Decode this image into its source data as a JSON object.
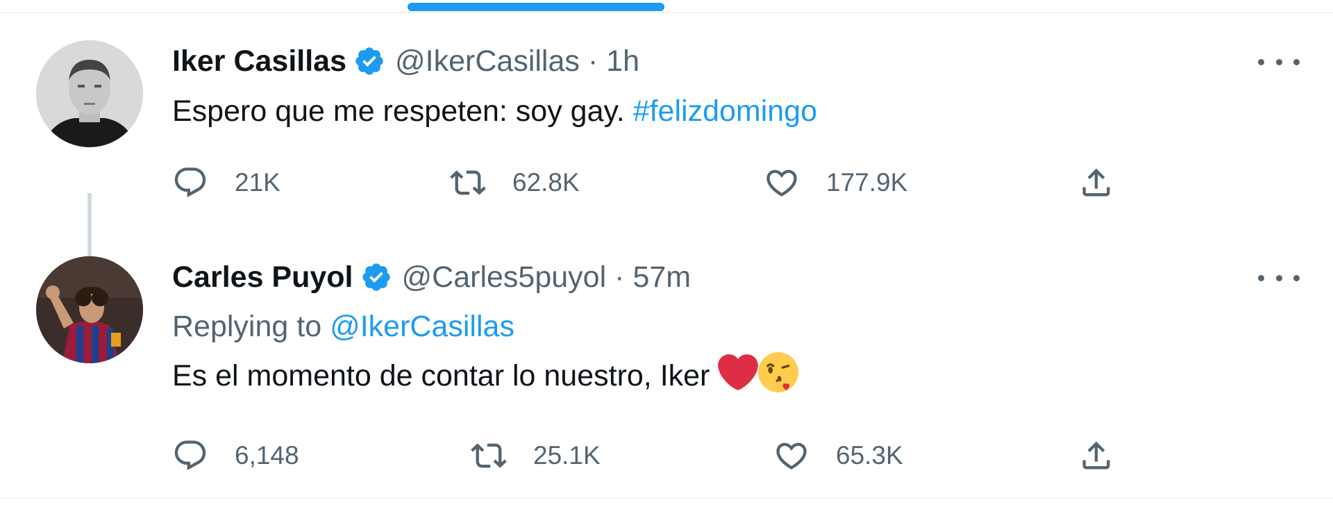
{
  "tabs": {
    "active_indicator_color": "#1d9bf0"
  },
  "tweets": [
    {
      "display_name": "Iker Casillas",
      "verified": true,
      "handle": "@IkerCasillas",
      "separator": "·",
      "time": "1h",
      "text_plain": "Espero que me respeten: soy gay. ",
      "hashtag": "#felizdomingo",
      "avatar_icon": "portrait-bw-avatar",
      "actions": {
        "replies": "21K",
        "retweets": "62.8K",
        "likes": "177.9K"
      }
    },
    {
      "display_name": "Carles Puyol",
      "verified": true,
      "handle": "@Carles5puyol",
      "separator": "·",
      "time": "57m",
      "replying_prefix": "Replying to ",
      "replying_to": "@IkerCasillas",
      "text_plain": "Es el momento de contar lo nuestro, Iker ",
      "emojis": [
        "red-heart-icon",
        "face-blowing-kiss-icon"
      ],
      "avatar_icon": "football-player-avatar",
      "actions": {
        "replies": "6,148",
        "retweets": "25.1K",
        "likes": "65.3K"
      }
    }
  ],
  "colors": {
    "accent": "#1d9bf0",
    "text_primary": "#0f1419",
    "text_secondary": "#536471",
    "heart": "#e0245e"
  }
}
